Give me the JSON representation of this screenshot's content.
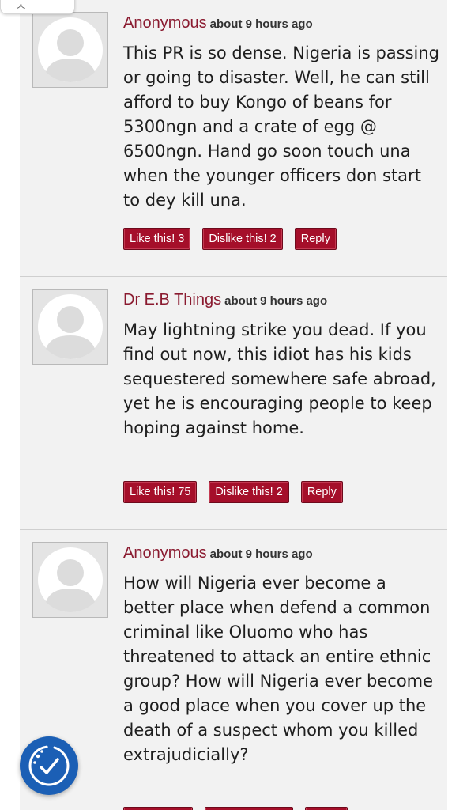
{
  "comments": [
    {
      "author": "Anonymous",
      "time": "about 9 hours ago",
      "text": "This PR is so dense. Nigeria is passing or going to disaster. Well, he can still afford to buy Kongo of beans for 5300ngn and a crate of egg @ 6500ngn. Hand go soon touch una when the younger officers don start to dey kill una.",
      "like_label": "Like this! 3",
      "dislike_label": "Dislike this! 2",
      "reply_label": "Reply"
    },
    {
      "author": "Dr E.B Things",
      "time": "about 9 hours ago",
      "text": "May lightning strike you dead. If you find out now, this idiot has his kids sequestered somewhere safe abroad, yet he is encouraging people to keep hoping against home.",
      "like_label": "Like this! 75",
      "dislike_label": "Dislike this! 2",
      "reply_label": "Reply"
    },
    {
      "author": "Anonymous",
      "time": "about 9 hours ago",
      "text": "How will Nigeria ever become a better place when defend a common criminal like Oluomo who has threatened to attack an entire ethnic group? How will Nigeria ever become a good place when you cover up the death of a suspect whom you killed extrajudicially?",
      "like_label": "",
      "dislike_label": "",
      "reply_label": ""
    }
  ],
  "icons": {
    "avatar": "default-user-avatar-icon",
    "fab": "accessibility-check-icon",
    "top": "partial-control-icon"
  },
  "colors": {
    "accent": "#a50f2a",
    "author": "#8a1a2f",
    "fab": "#1b5fb5",
    "panel": "#f2f2f2"
  }
}
